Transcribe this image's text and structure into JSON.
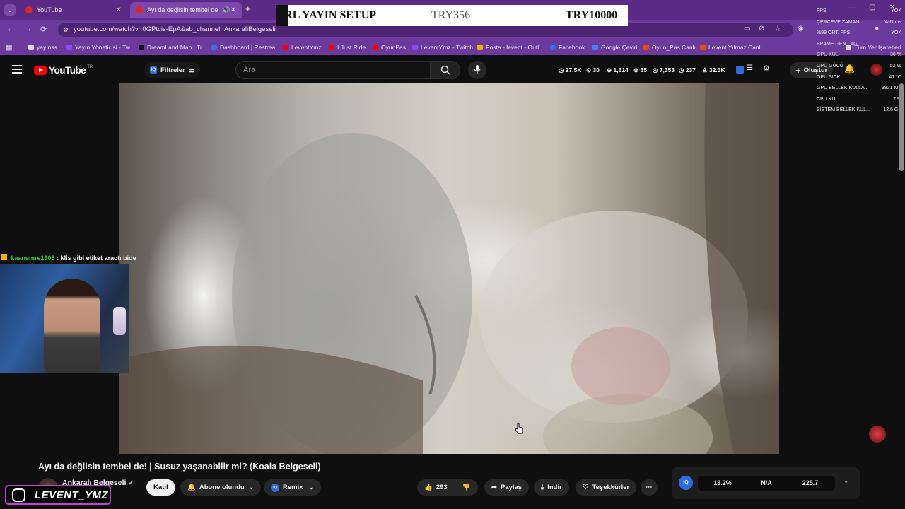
{
  "browser": {
    "tabs": [
      {
        "label": "YouTube"
      },
      {
        "label": "Ayı da değilsin tembel de! |"
      }
    ],
    "url": "youtube.com/watch?v=0GPtcis-EpA&ab_channel=AnkaraliBelgeseli",
    "bookmarks": [
      {
        "label": "yayınss"
      },
      {
        "label": "Yayın Yöneticisi - Tw..."
      },
      {
        "label": "DreamLand Map | Tr..."
      },
      {
        "label": "Dashboard | Restrea..."
      },
      {
        "label": "LeventYmz"
      },
      {
        "label": "I Just Ride"
      },
      {
        "label": "OyunPas"
      },
      {
        "label": "LeventYmz - Twitch"
      },
      {
        "label": "Posta - levent - Outl..."
      },
      {
        "label": "Facebook"
      },
      {
        "label": "Google Çeviri"
      },
      {
        "label": "Oyun_Pas Canlı"
      },
      {
        "label": "Levent Yılmaz Canlı"
      },
      {
        "label": "Tüm Yer İşaretleri"
      }
    ]
  },
  "overlay": {
    "setup_title": "IRL YAYIN SETUP",
    "amount_current": "TRY356",
    "amount_goal": "TRY10000"
  },
  "perf_stats": [
    {
      "label": "FPS",
      "value": "YOK"
    },
    {
      "label": "ÇERÇEVE ZAMANI",
      "value": "NaN ms"
    },
    {
      "label": "%99 ORT. FPS",
      "value": "YOK"
    },
    {
      "label": "FRAME GEN LAG",
      "value": ""
    },
    {
      "label": "GPU KUL",
      "value": "36 %"
    },
    {
      "label": "GPU GÜCÜ",
      "value": "53 W"
    },
    {
      "label": "GPU SICKL",
      "value": "41 °C"
    },
    {
      "label": "GPU BELLEK KULLA...",
      "value": "3821 MB"
    },
    {
      "label": "CPU KUL",
      "value": "7 %"
    },
    {
      "label": "SİSTEM BELLEK KUL...",
      "value": "12.6 GB"
    }
  ],
  "youtube": {
    "logo_text": "YouTube",
    "logo_region": "TR",
    "filters_label": "Filtreler",
    "search_placeholder": "Ara",
    "create_label": "Oluştur",
    "header_stats": [
      "27.5K",
      "30",
      "1,614",
      "65",
      "7,353",
      "237",
      "32.3K"
    ],
    "video_title": "Ayı da değilsin tembel de! | Susuz yaşanabilir mi? (Koala Belgeseli)",
    "channel_name": "Ankaralı Belgeseli",
    "join_label": "Katıl",
    "subscribed_label": "Abone olundu",
    "remix_label": "Remix",
    "like_count": "293",
    "share_label": "Paylaş",
    "download_label": "İndir",
    "thanks_label": "Teşekkürler",
    "widget_values": [
      "18.2%",
      "N/A",
      "225.7"
    ]
  },
  "stream": {
    "chat_user": "kaanemre1903",
    "chat_message": ": Mis gibi etiket aractı bide",
    "brand": "LEVENT_YMZ"
  },
  "colors": {
    "tab_bar": "#5b2a86",
    "address_bar": "#6c3a9c",
    "youtube_red": "#ff0000",
    "chat_user": "#2ecc40",
    "brand_border": "#c53fd8"
  }
}
